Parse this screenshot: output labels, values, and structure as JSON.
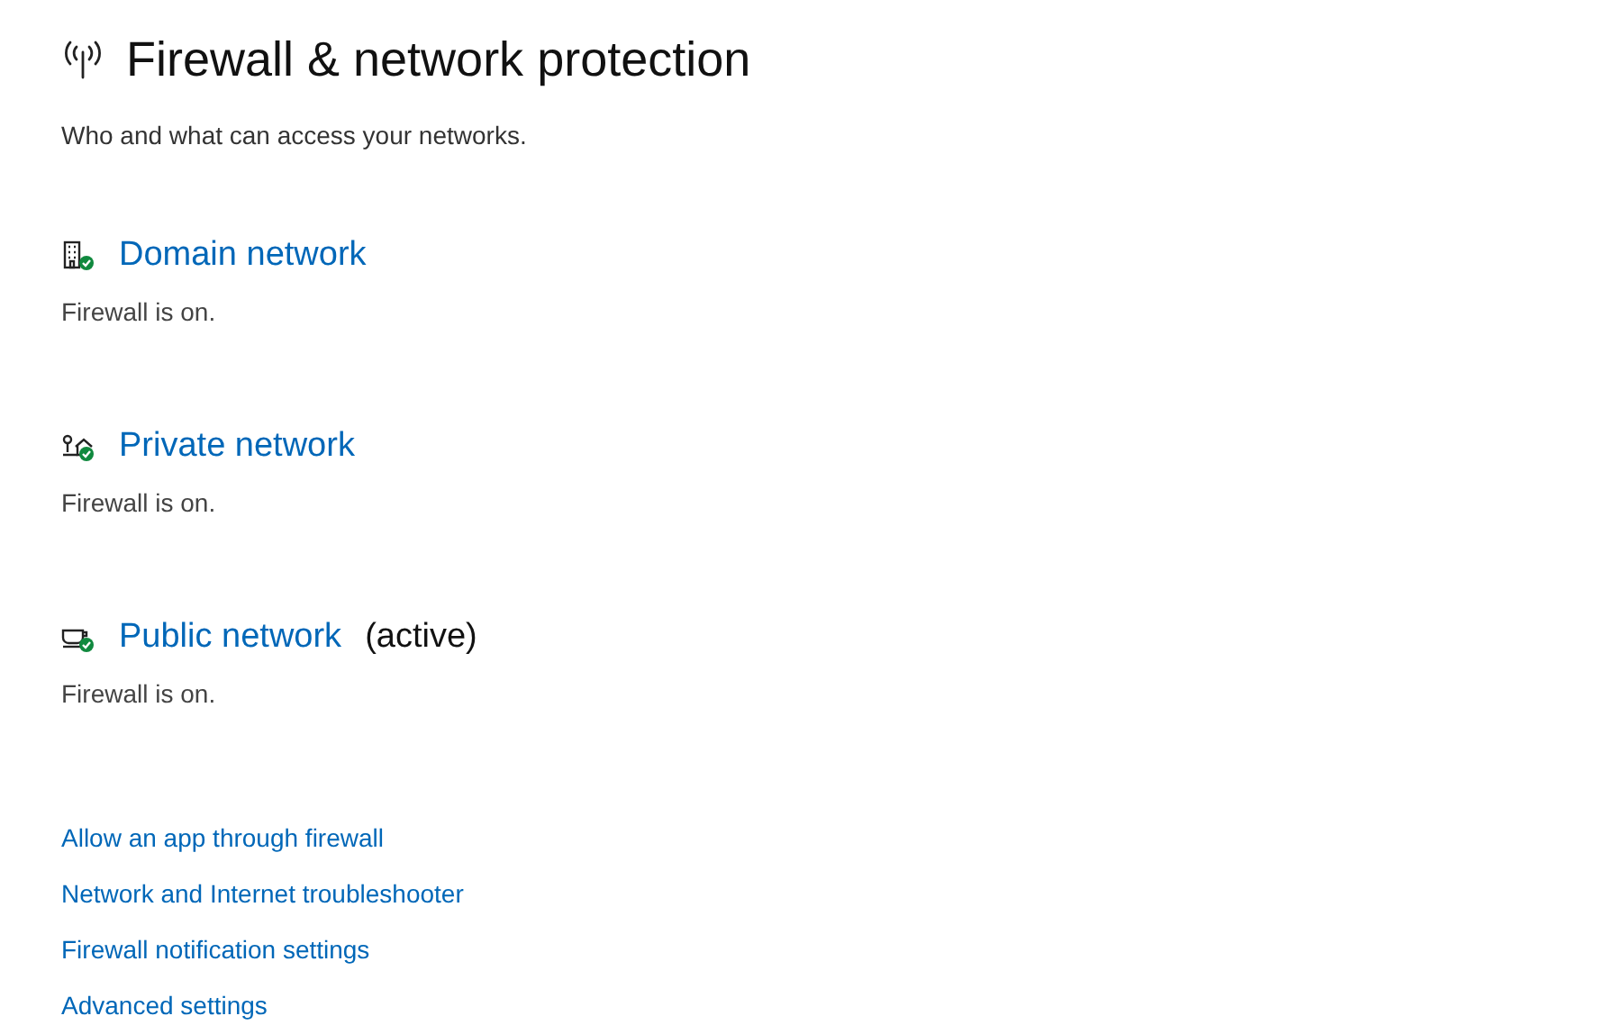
{
  "header": {
    "title": "Firewall & network protection",
    "subtitle": "Who and what can access your networks."
  },
  "networks": [
    {
      "kind": "domain",
      "name": "Domain network",
      "status": "Firewall is on."
    },
    {
      "kind": "private",
      "name": "Private network",
      "status": "Firewall is on."
    },
    {
      "kind": "public",
      "name": "Public network",
      "tag": "(active)",
      "status": "Firewall is on."
    }
  ],
  "links": [
    "Allow an app through firewall",
    "Network and Internet troubleshooter",
    "Firewall notification settings",
    "Advanced settings"
  ]
}
